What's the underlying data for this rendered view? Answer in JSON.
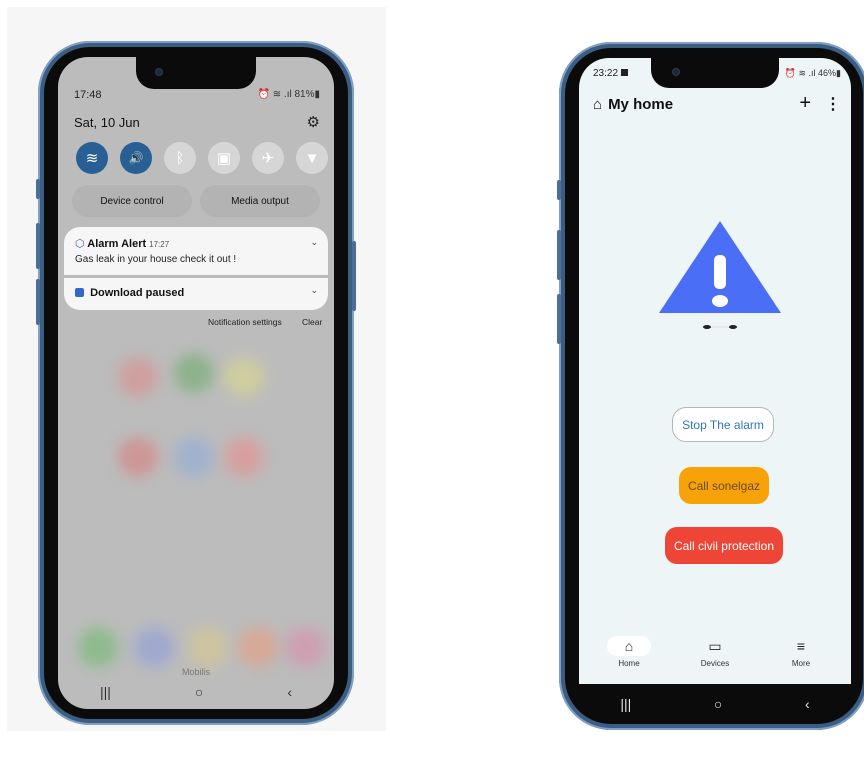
{
  "left_phone": {
    "status": {
      "time": "17:48",
      "indicators": "⏰ ≋ .ıl 81%▮"
    },
    "date": "Sat, 10 Jun",
    "quick_settings": [
      {
        "name": "wifi",
        "glyph": "≋",
        "on": true
      },
      {
        "name": "sound",
        "glyph": "🔊",
        "on": true
      },
      {
        "name": "bluetooth",
        "glyph": "ᛒ",
        "on": false
      },
      {
        "name": "auto-rotate",
        "glyph": "▣",
        "on": false
      },
      {
        "name": "airplane",
        "glyph": "✈",
        "on": false
      },
      {
        "name": "flashlight",
        "glyph": "▼",
        "on": false
      }
    ],
    "device_control": "Device control",
    "media_output": "Media output",
    "notifications": [
      {
        "title": "Alarm Alert",
        "time": "17:27",
        "body": "Gas leak in your house check it out !"
      },
      {
        "title": "Download paused"
      }
    ],
    "notification_settings": "Notification settings",
    "clear": "Clear",
    "carrier": "Mobilis"
  },
  "right_phone": {
    "status": {
      "time": "23:22",
      "indicators": "⏰ ≋ .ıl 46%▮"
    },
    "title": "My home",
    "buttons": {
      "stop": "Stop The alarm",
      "sonelgaz": "Call sonelgaz",
      "civil": "Call civil protection"
    },
    "colors": {
      "warning": "#4a6ef5",
      "sonelgaz": "#f8a20a",
      "civil": "#ee4536"
    },
    "bottom_nav": [
      {
        "label": "Home",
        "icon": "home-icon",
        "selected": true
      },
      {
        "label": "Devices",
        "icon": "devices-icon",
        "selected": false
      },
      {
        "label": "More",
        "icon": "menu-icon",
        "selected": false
      }
    ]
  },
  "system_nav": {
    "recent": "|||",
    "home": "○",
    "back": "‹"
  }
}
